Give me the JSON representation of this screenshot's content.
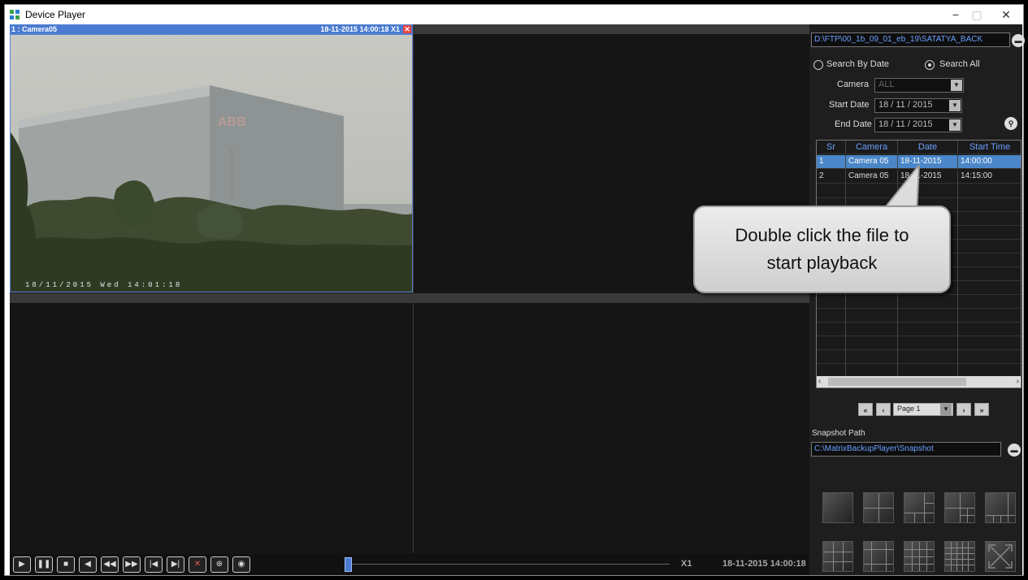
{
  "window": {
    "title": "Device Player",
    "controls": {
      "minimize": "−",
      "maximize": "▢",
      "close": "✕"
    }
  },
  "tiles": [
    {
      "label": "1 : Camera05",
      "timestamp": "18-11-2015 14:00:18 X1",
      "close": "✕",
      "overlay": "18/11/2015 Wed 14:01:18",
      "building_text": "ABB"
    }
  ],
  "controls": {
    "speed": "X1",
    "current_time": "18-11-2015 14:00:18",
    "progress": 0.02
  },
  "panel": {
    "path": "D:\\FTP\\00_1b_09_01_eb_19\\SATATYA_BACK",
    "search_by_date_label": "Search By Date",
    "search_all_label": "Search All",
    "camera_label": "Camera",
    "camera_value": "ALL",
    "start_date_label": "Start Date",
    "start_date_value": "18 / 11 / 2015",
    "end_date_label": "End Date",
    "end_date_value": "18 / 11 / 2015",
    "table": {
      "headers": [
        "Sr",
        "Camera",
        "Date",
        "Start Time"
      ],
      "rows": [
        [
          "1",
          "Camera 05",
          "18-11-2015",
          "14:00:00"
        ],
        [
          "2",
          "Camera 05",
          "18-11-2015",
          "14:15:00"
        ]
      ]
    },
    "page_value": "Page 1",
    "snapshot_path_label": "Snapshot Path",
    "snapshot_path_value": "C:\\MatrixBackupPlayer\\Snapshot"
  },
  "callout": {
    "line1": "Double click the file to",
    "line2": "start playback"
  },
  "colors": {
    "accent": "#4a7bd0",
    "panel_bg": "#1e1e1e",
    "video_bg": "#151515",
    "selected_row": "#4a86c8"
  }
}
